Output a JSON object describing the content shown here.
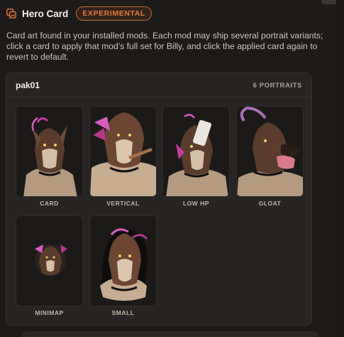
{
  "header": {
    "title": "Hero Card",
    "badge": "EXPERIMENTAL",
    "icon": "image-swap-icon",
    "accent": "#e8773a"
  },
  "description": "Card art found in your installed mods. Each mod may ship several portrait variants; click a card to apply that mod's full set for Billy, and click the applied card again to revert to default.",
  "panel": {
    "name": "pak01",
    "count": "6 PORTRAITS",
    "portraits": [
      {
        "label": "CARD"
      },
      {
        "label": "VERTICAL"
      },
      {
        "label": "LOW HP"
      },
      {
        "label": "GLOAT"
      },
      {
        "label": "MINIMAP"
      },
      {
        "label": "SMALL"
      }
    ]
  }
}
